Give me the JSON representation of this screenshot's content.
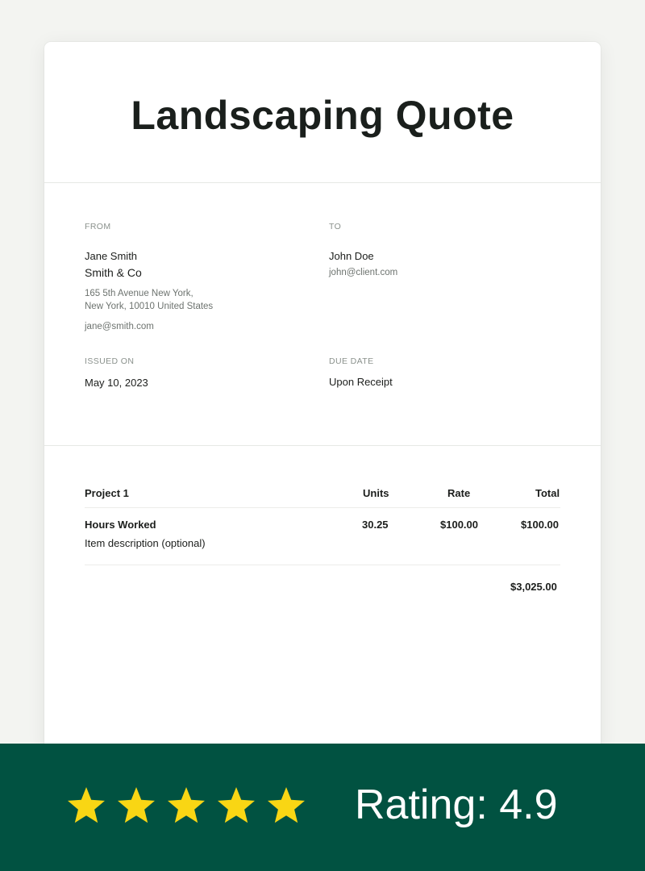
{
  "document": {
    "title": "Landscaping Quote",
    "from": {
      "label": "FROM",
      "name": "Jane Smith",
      "company": "Smith & Co",
      "address_line1": "165 5th Avenue New York,",
      "address_line2": "New York, 10010 United States",
      "email": "jane@smith.com"
    },
    "to": {
      "label": "TO",
      "name": "John Doe",
      "email": "john@client.com"
    },
    "issued": {
      "label": "ISSUED ON",
      "value": "May 10, 2023"
    },
    "due": {
      "label": "DUE DATE",
      "value": "Upon Receipt"
    },
    "table": {
      "headers": {
        "project": "Project 1",
        "units": "Units",
        "rate": "Rate",
        "total": "Total"
      },
      "rows": [
        {
          "name": "Hours Worked",
          "description": "Item description (optional)",
          "units": "30.25",
          "rate": "$100.00",
          "total": "$100.00"
        }
      ],
      "grand_total": "$3,025.00"
    }
  },
  "footer": {
    "rating_text": "Rating: 4.9",
    "stars": 5,
    "star_color": "#f9d614",
    "background_color": "#015241"
  }
}
